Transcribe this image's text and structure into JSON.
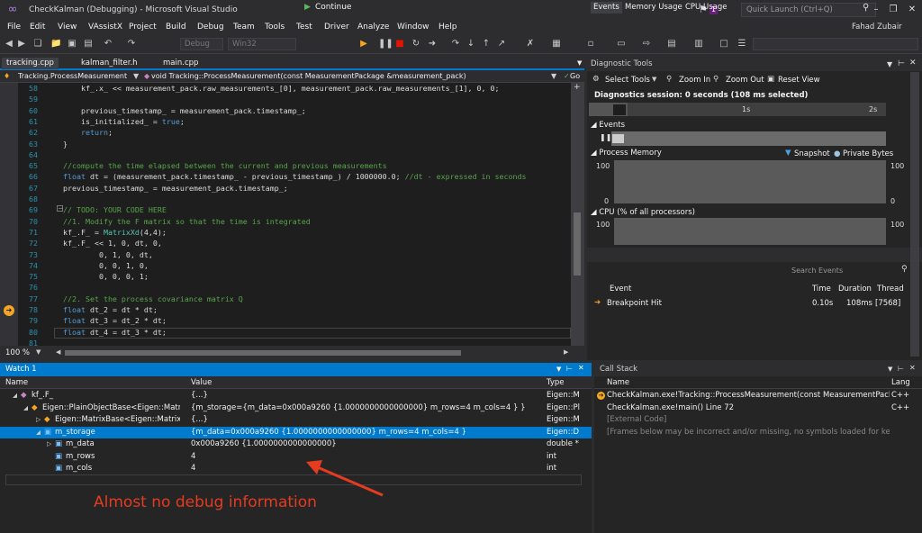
{
  "title": "CheckKalman (Debugging) - Microsoft Visual Studio",
  "notif_count": "1",
  "quick_launch": "Quick Launch (Ctrl+Q)",
  "user": "Fahad Zubair",
  "menu": [
    "File",
    "Edit",
    "View",
    "VAssistX",
    "Project",
    "Build",
    "Debug",
    "Team",
    "Tools",
    "Test",
    "Driver",
    "Analyze",
    "Window",
    "Help"
  ],
  "toolbar": {
    "config": "Debug",
    "platform": "Win32",
    "continue": "Continue"
  },
  "editor": {
    "tabs": [
      "tracking.cpp",
      "kalman_filter.h",
      "main.cpp"
    ],
    "nav_left": "Tracking.ProcessMeasurement",
    "nav_right": "void Tracking::ProcessMeasurement(const MeasurementPackage &measurement_pack)",
    "nav_go": "Go",
    "zoom": "100 %",
    "lines": [
      {
        "n": "58",
        "t": "      kf_.x_ << measurement_pack.raw_measurements_[0], measurement_pack.raw_measurements_[1], 0, 0;"
      },
      {
        "n": "59",
        "t": ""
      },
      {
        "n": "60",
        "t": "      previous_timestamp_ = measurement_pack.timestamp_;"
      },
      {
        "n": "61",
        "t": "      is_initialized_ = true;"
      },
      {
        "n": "62",
        "t": "      return;"
      },
      {
        "n": "63",
        "t": "  }"
      },
      {
        "n": "64",
        "t": ""
      },
      {
        "n": "65",
        "t": "  //compute the time elapsed between the current and previous measurements"
      },
      {
        "n": "66",
        "t": "  float dt = (measurement_pack.timestamp_ - previous_timestamp_) / 1000000.0; //dt - expressed in seconds"
      },
      {
        "n": "67",
        "t": "  previous_timestamp_ = measurement_pack.timestamp_;"
      },
      {
        "n": "68",
        "t": ""
      },
      {
        "n": "69",
        "t": "  // TODO: YOUR CODE HERE"
      },
      {
        "n": "70",
        "t": "  //1. Modify the F matrix so that the time is integrated"
      },
      {
        "n": "71",
        "t": "  kf_.F_ = MatrixXd(4,4);"
      },
      {
        "n": "72",
        "t": "  kf_.F_ << 1, 0, dt, 0,"
      },
      {
        "n": "73",
        "t": "          0, 1, 0, dt,"
      },
      {
        "n": "74",
        "t": "          0, 0, 1, 0,"
      },
      {
        "n": "75",
        "t": "          0, 0, 0, 1;"
      },
      {
        "n": "76",
        "t": ""
      },
      {
        "n": "77",
        "t": "  //2. Set the process covariance matrix Q"
      },
      {
        "n": "78",
        "t": "  float dt_2 = dt * dt;"
      },
      {
        "n": "79",
        "t": "  float dt_3 = dt_2 * dt;"
      },
      {
        "n": "80",
        "t": "  float dt_4 = dt_3 * dt;"
      },
      {
        "n": "81",
        "t": ""
      }
    ]
  },
  "diag": {
    "title": "Diagnostic Tools",
    "select_tools": "Select Tools",
    "zoom_in": "Zoom In",
    "zoom_out": "Zoom Out",
    "reset_view": "Reset View",
    "session": "Diagnostics session: 0 seconds (108 ms selected)",
    "ruler_1": "1s",
    "ruler_2": "2s",
    "events_label": "Events",
    "memory_label": "Process Memory",
    "snapshot": "Snapshot",
    "private_bytes": "Private Bytes",
    "mem_top_left": "100",
    "mem_top_right": "100",
    "mem_bot_left": "0",
    "mem_bot_right": "0",
    "cpu_label": "CPU (% of all processors)",
    "cpu_top_left": "100",
    "cpu_top_right": "100",
    "tabs": [
      "Events",
      "Memory Usage",
      "CPU Usage"
    ],
    "search": "Search Events",
    "cols": [
      "Event",
      "Time",
      "Duration",
      "Thread"
    ],
    "row": {
      "event": "Breakpoint Hit",
      "time": "0.10s",
      "duration": "108ms",
      "thread": "[7568]"
    }
  },
  "watch": {
    "title": "Watch 1",
    "cols": [
      "Name",
      "Value",
      "Type"
    ],
    "rows": [
      {
        "name": "kf_.F_",
        "value": "{...}",
        "type": "Eigen::M"
      },
      {
        "name": "Eigen::PlainObjectBase<Eigen::Matrix<",
        "value": "{m_storage={m_data=0x000a9260 {1.0000000000000000} m_rows=4 m_cols=4 } }",
        "type": "Eigen::Pl"
      },
      {
        "name": "Eigen::MatrixBase<Eigen::Matrix<d",
        "value": "{...}",
        "type": "Eigen::M"
      },
      {
        "name": "m_storage",
        "value": "{m_data=0x000a9260 {1.0000000000000000} m_rows=4 m_cols=4 }",
        "type": "Eigen::D"
      },
      {
        "name": "m_data",
        "value": "0x000a9260 {1.0000000000000000}",
        "type": "double *"
      },
      {
        "name": "m_rows",
        "value": "4",
        "type": "int"
      },
      {
        "name": "m_cols",
        "value": "4",
        "type": "int"
      }
    ]
  },
  "callstack": {
    "title": "Call Stack",
    "cols": [
      "Name",
      "Lang"
    ],
    "rows": [
      {
        "name": "CheckKalman.exe!Tracking::ProcessMeasurement(const MeasurementPackag",
        "lang": "C++"
      },
      {
        "name": "CheckKalman.exe!main() Line 72",
        "lang": "C++"
      },
      {
        "name": "[External Code]",
        "lang": ""
      },
      {
        "name": "[Frames below may be incorrect and/or missing, no symbols loaded for kern",
        "lang": ""
      }
    ]
  },
  "annotation": "Almost no debug information",
  "colors": {
    "accent": "#007acc",
    "annotation": "#e53b1f",
    "breakpoint": "#f5a623"
  }
}
